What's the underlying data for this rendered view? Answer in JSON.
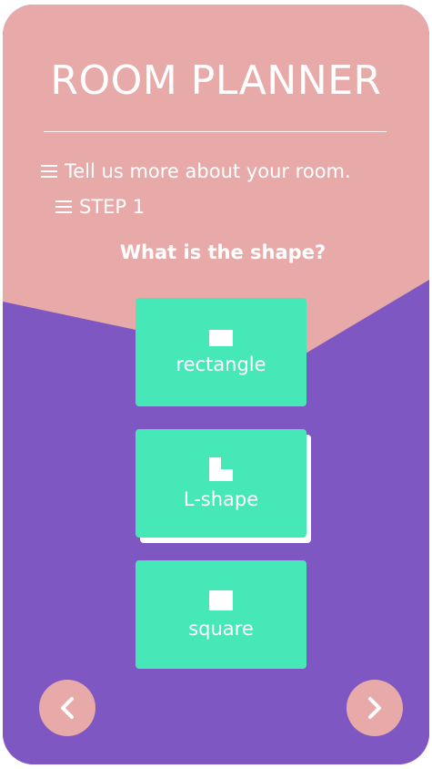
{
  "app": {
    "title": "ROOM PLANNER"
  },
  "intro": {
    "subtitle": "Tell us more about your room.",
    "step": "STEP 1"
  },
  "question": "What is the shape?",
  "options": [
    {
      "label": "rectangle",
      "icon": "rectangle-icon"
    },
    {
      "label": "L-shape",
      "icon": "l-shape-icon"
    },
    {
      "label": "square",
      "icon": "square-icon"
    }
  ],
  "navigation": {
    "prev_icon": "chevron-left-icon",
    "next_icon": "chevron-right-icon"
  },
  "colors": {
    "background_top": "#e8aaa9",
    "background_bottom": "#7e57c2",
    "option_button": "#47e8b8",
    "text": "#ffffff"
  }
}
